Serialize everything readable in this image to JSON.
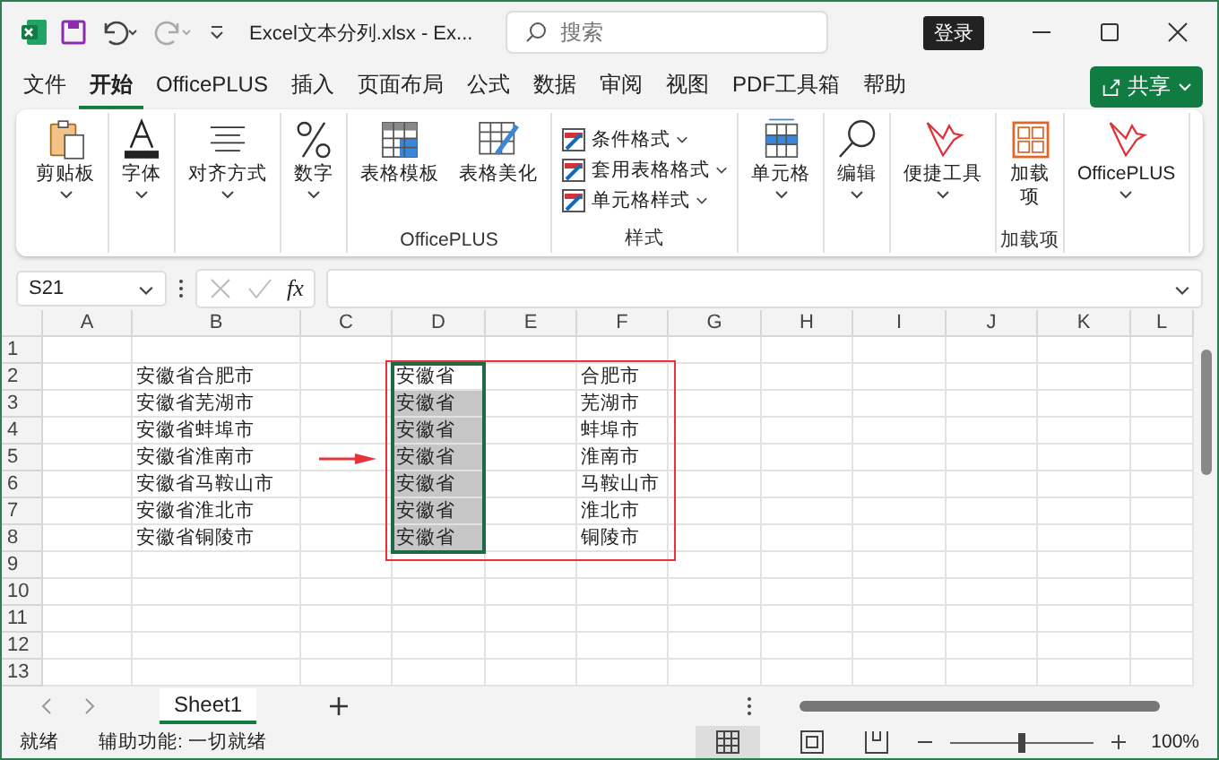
{
  "window": {
    "title": "Excel文本分列.xlsx  -  Ex...",
    "search": {
      "placeholder": "搜索"
    },
    "login": "登录"
  },
  "menu": {
    "tabs": [
      {
        "label": "文件",
        "selected": false
      },
      {
        "label": "开始",
        "selected": true
      },
      {
        "label": "OfficePLUS",
        "selected": false
      },
      {
        "label": "插入",
        "selected": false
      },
      {
        "label": "页面布局",
        "selected": false
      },
      {
        "label": "公式",
        "selected": false
      },
      {
        "label": "数据",
        "selected": false
      },
      {
        "label": "审阅",
        "selected": false
      },
      {
        "label": "视图",
        "selected": false
      },
      {
        "label": "PDF工具箱",
        "selected": false
      },
      {
        "label": "帮助",
        "selected": false
      }
    ],
    "share": "共享"
  },
  "ribbon": {
    "groups": [
      {
        "items": [
          {
            "kind": "clipboard",
            "label": "剪贴板",
            "dropdown": true
          }
        ]
      },
      {
        "items": [
          {
            "kind": "font",
            "label": "字体",
            "dropdown": true
          }
        ]
      },
      {
        "items": [
          {
            "kind": "align",
            "label": "对齐方式",
            "dropdown": true
          }
        ]
      },
      {
        "items": [
          {
            "kind": "percent",
            "label": "数字",
            "dropdown": true
          }
        ]
      },
      {
        "label": "OfficePLUS",
        "items": [
          {
            "kind": "table",
            "label": "表格模板",
            "dropdown": false
          },
          {
            "kind": "brush",
            "label": "表格美化",
            "dropdown": false
          }
        ]
      },
      {
        "label": "样式",
        "items": [
          {
            "kind": "small",
            "label": "条件格式",
            "dropdown": true
          },
          {
            "kind": "small",
            "label": "套用表格格式",
            "dropdown": true
          },
          {
            "kind": "small",
            "label": "单元格样式",
            "dropdown": true
          }
        ]
      },
      {
        "items": [
          {
            "kind": "cells",
            "label": "单元格",
            "dropdown": true
          }
        ]
      },
      {
        "items": [
          {
            "kind": "search",
            "label": "编辑",
            "dropdown": true
          }
        ]
      },
      {
        "items": [
          {
            "kind": "bird",
            "label": "便捷工具",
            "dropdown": true
          }
        ]
      },
      {
        "label": "加载项",
        "items": [
          {
            "kind": "grid",
            "label": "加载项",
            "dropdown": false
          }
        ]
      },
      {
        "items": [
          {
            "kind": "bird",
            "label": "OfficePLUS",
            "dropdown": true
          }
        ]
      }
    ]
  },
  "formula_bar": {
    "name_box": "S21",
    "function_label": "fx"
  },
  "sheet": {
    "columns": [
      "A",
      "B",
      "C",
      "D",
      "E",
      "F",
      "G",
      "H",
      "I",
      "J",
      "K",
      "L"
    ],
    "rows": [
      {
        "number": "1"
      },
      {
        "number": "2",
        "b": "安徽省合肥市",
        "d": "安徽省",
        "f": "合肥市",
        "active": true,
        "selected": true
      },
      {
        "number": "3",
        "b": "安徽省芜湖市",
        "d": "安徽省",
        "f": "芜湖市",
        "active": false,
        "selected": true
      },
      {
        "number": "4",
        "b": "安徽省蚌埠市",
        "d": "安徽省",
        "f": "蚌埠市",
        "active": false,
        "selected": true
      },
      {
        "number": "5",
        "b": "安徽省淮南市",
        "d": "安徽省",
        "f": "淮南市",
        "active": false,
        "selected": true
      },
      {
        "number": "6",
        "b": "安徽省马鞍山市",
        "d": "安徽省",
        "f": "马鞍山市",
        "active": false,
        "selected": true
      },
      {
        "number": "7",
        "b": "安徽省淮北市",
        "d": "安徽省",
        "f": "淮北市",
        "active": false,
        "selected": true
      },
      {
        "number": "8",
        "b": "安徽省铜陵市",
        "d": "安徽省",
        "f": "铜陵市",
        "active": false,
        "selected": true
      },
      {
        "number": "9"
      },
      {
        "number": "10"
      },
      {
        "number": "11"
      },
      {
        "number": "12"
      },
      {
        "number": "13"
      }
    ]
  },
  "sheet_tabs": [
    {
      "label": "Sheet1",
      "selected": true
    }
  ],
  "status_bar": {
    "ready": "就绪",
    "accessibility": "辅助功能: 一切就绪",
    "zoom": "100%",
    "zoom_slider": {
      "level": 0.5
    }
  }
}
